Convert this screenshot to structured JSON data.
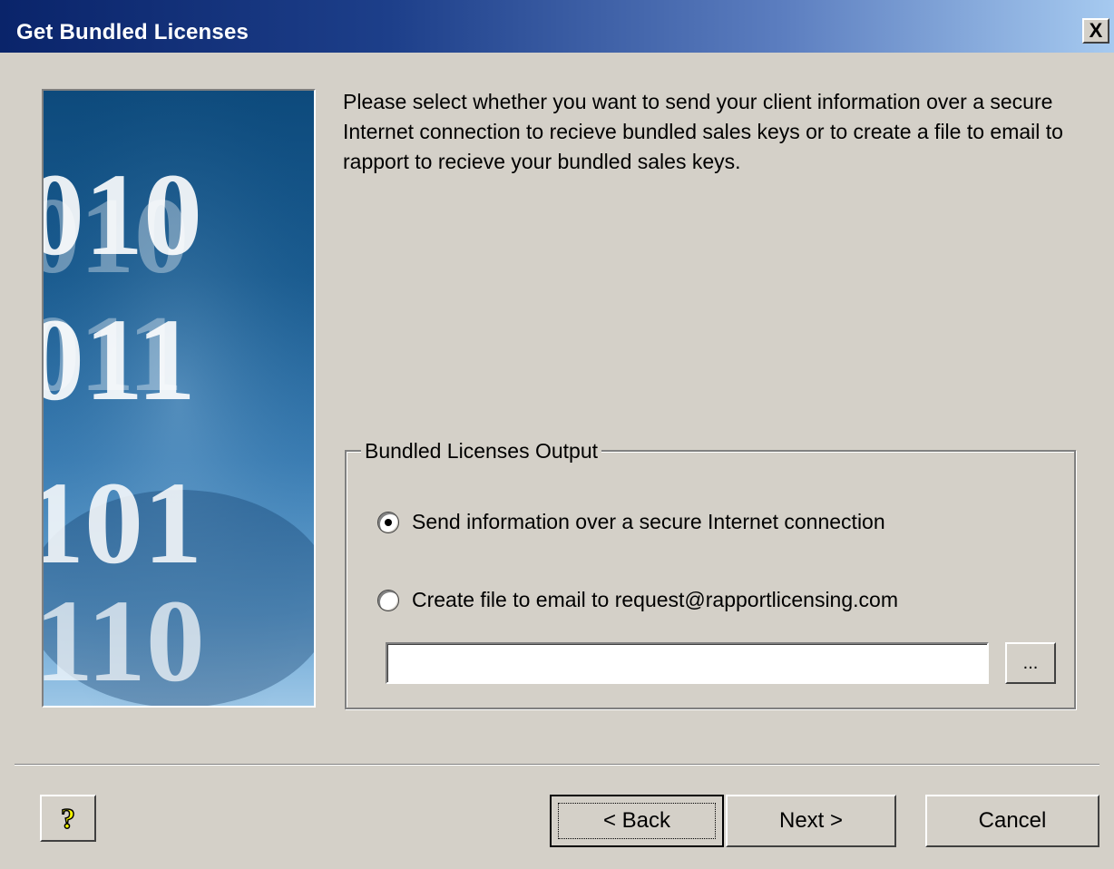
{
  "window": {
    "title": "Get Bundled Licenses",
    "close_label": "X"
  },
  "intro_text": "Please select whether you want to send your client information over a secure Internet connection to recieve bundled sales keys or to create a file to email to rapport to recieve your bundled sales keys.",
  "output_group": {
    "label": "Bundled Licenses Output",
    "options": [
      {
        "label": "Send information over a secure Internet connection",
        "selected": true
      },
      {
        "label": "Create file to email to request@rapportlicensing.com",
        "selected": false
      }
    ],
    "file_path_value": "",
    "browse_label": "..."
  },
  "buttons": {
    "help_icon": "question-mark-icon",
    "back": "< Back",
    "next": "Next >",
    "cancel": "Cancel"
  },
  "side_image_digits": [
    "010",
    "011",
    "101",
    "110"
  ]
}
